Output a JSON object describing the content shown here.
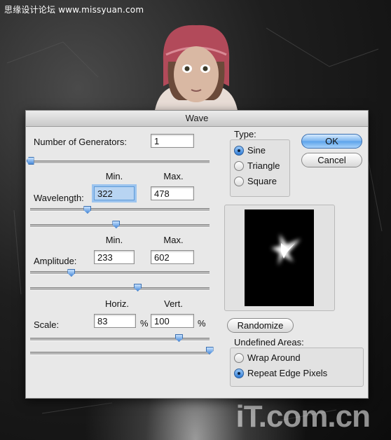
{
  "watermarks": {
    "top": "思缘设计论坛 www.missyuan.com",
    "bottom": "iT.com.cn"
  },
  "dialog": {
    "title": "Wave",
    "generators": {
      "label": "Number of Generators:",
      "value": "1",
      "slider_fraction": 0.0
    },
    "wavelength": {
      "label": "Wavelength:",
      "min_header": "Min.",
      "max_header": "Max.",
      "min_value": "322",
      "max_value": "478",
      "min_slider_fraction": 0.32,
      "max_slider_fraction": 0.48
    },
    "amplitude": {
      "label": "Amplitude:",
      "min_header": "Min.",
      "max_header": "Max.",
      "min_value": "233",
      "max_value": "602",
      "min_slider_fraction": 0.23,
      "max_slider_fraction": 0.6
    },
    "scale": {
      "label": "Scale:",
      "horiz_header": "Horiz.",
      "vert_header": "Vert.",
      "horiz_value": "83",
      "vert_value": "100",
      "unit": "%",
      "horiz_slider_fraction": 0.83,
      "vert_slider_fraction": 1.0
    },
    "type": {
      "label": "Type:",
      "options": [
        "Sine",
        "Triangle",
        "Square"
      ],
      "selected": "Sine"
    },
    "buttons": {
      "ok": "OK",
      "cancel": "Cancel",
      "randomize": "Randomize"
    },
    "undefined_areas": {
      "label": "Undefined Areas:",
      "options": [
        "Wrap Around",
        "Repeat Edge Pixels"
      ],
      "selected": "Repeat Edge Pixels"
    }
  },
  "colors": {
    "accent": "#5ba2ea",
    "dialog_bg": "#e8e8e8"
  }
}
